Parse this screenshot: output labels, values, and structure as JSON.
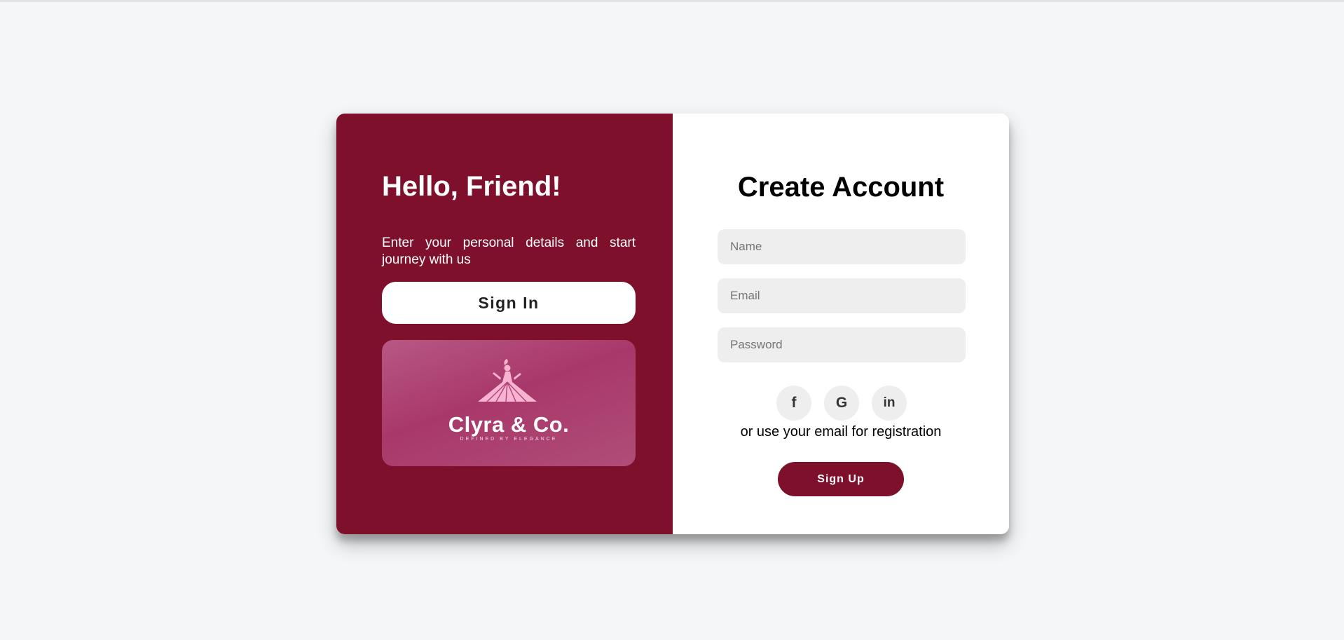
{
  "left_panel": {
    "heading": "Hello, Friend!",
    "subtext": "Enter your personal details and start journey with us",
    "signin_label": "Sign In",
    "logo": {
      "name": "Clyra & Co.",
      "tagline": "DEFINED BY ELEGANCE"
    }
  },
  "right_panel": {
    "heading": "Create Account",
    "fields": {
      "name_placeholder": "Name",
      "email_placeholder": "Email",
      "password_placeholder": "Password"
    },
    "social": [
      {
        "icon": "facebook-icon",
        "glyph": "f"
      },
      {
        "icon": "google-icon",
        "glyph": "G"
      },
      {
        "icon": "linkedin-icon",
        "glyph": "in"
      }
    ],
    "or_text": "or use your email for registration",
    "signup_label": "Sign Up"
  },
  "colors": {
    "brand": "#7e102c",
    "field_bg": "#eeeeee",
    "page_bg": "#f5f6f8"
  }
}
